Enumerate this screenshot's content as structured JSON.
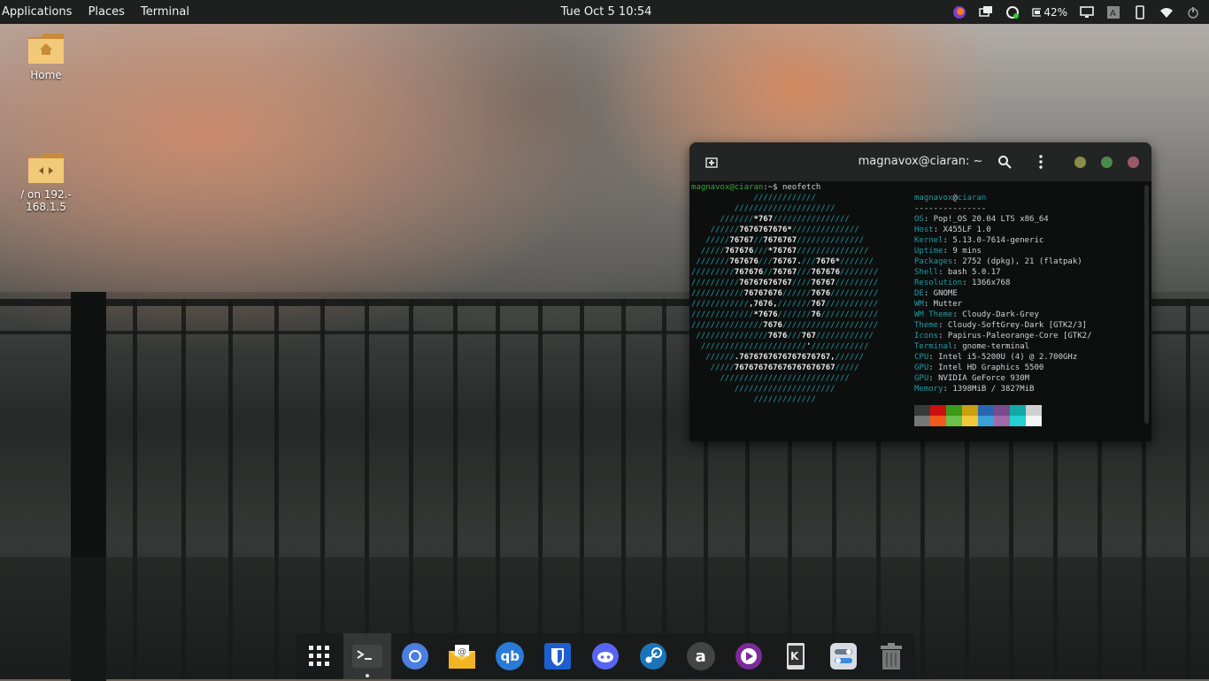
{
  "topbar": {
    "menus": [
      "Applications",
      "Places",
      "Terminal"
    ],
    "clock": "Tue Oct 5 10:54",
    "battery": "42%"
  },
  "desktop": {
    "icons": [
      {
        "label": "Home"
      },
      {
        "label": "/ on 192.-\n168.1.5"
      }
    ]
  },
  "terminal": {
    "title": "magnavox@ciaran: ~",
    "prompt_user": "magnavox@ciaran",
    "prompt_rest": ":~$ neofetch",
    "info_header_user": "magnavox",
    "info_header_at": "@",
    "info_header_host": "ciaran",
    "info_separator": "---------------",
    "info": [
      {
        "k": "OS",
        "v": "Pop!_OS 20.04 LTS x86_64"
      },
      {
        "k": "Host",
        "v": "X455LF 1.0"
      },
      {
        "k": "Kernel",
        "v": "5.13.0-7614-generic"
      },
      {
        "k": "Uptime",
        "v": "9 mins"
      },
      {
        "k": "Packages",
        "v": "2752 (dpkg), 21 (flatpak)"
      },
      {
        "k": "Shell",
        "v": "bash 5.0.17"
      },
      {
        "k": "Resolution",
        "v": "1366x768"
      },
      {
        "k": "DE",
        "v": "GNOME"
      },
      {
        "k": "WM",
        "v": "Mutter"
      },
      {
        "k": "WM Theme",
        "v": "Cloudy-Dark-Grey"
      },
      {
        "k": "Theme",
        "v": "Cloudy-SoftGrey-Dark [GTK2/3]"
      },
      {
        "k": "Icons",
        "v": "Papirus-Paleorange-Core [GTK2/"
      },
      {
        "k": "Terminal",
        "v": "gnome-terminal"
      },
      {
        "k": "CPU",
        "v": "Intel i5-5200U (4) @ 2.700GHz"
      },
      {
        "k": "GPU",
        "v": "Intel HD Graphics 5500"
      },
      {
        "k": "GPU",
        "v": "NVIDIA GeForce 930M"
      },
      {
        "k": "Memory",
        "v": "1398MiB / 3827MiB"
      }
    ],
    "swatches_dark": [
      "#3a3a3a",
      "#cc1010",
      "#3a9a1a",
      "#c8a010",
      "#2a66b0",
      "#7a4a8a",
      "#12a8a8",
      "#d0d0d0"
    ],
    "swatches_light": [
      "#777777",
      "#f05a1a",
      "#6cc04a",
      "#f0c838",
      "#3aa0d8",
      "#a06aa8",
      "#24d0d0",
      "#f4f4f4"
    ],
    "logo_lines": [
      "             /////////////",
      "         /////////////////////",
      "      ///////*767////////////////",
      "    //////7676767676*//////////////",
      "   /////76767//7676767//////////////",
      "  /////767676///*76767///////////////",
      " ///////767676///76767.///7676*///////",
      "/////////767676//76767///767676////////",
      "//////////76767676767////76767/////////",
      "///////////76767676//////7676//////////",
      "////////////,7676,///////767///////////",
      "/////////////*7676///////76////////////",
      "///////////////7676////////////////////",
      " ///////////////7676///767////////////",
      "  //////////////////////'////////////",
      "   //////.7676767676767676767,//////",
      "    /////767676767676767676767/////",
      "      ///////////////////////////",
      "         /////////////////////",
      "             /////////////"
    ]
  },
  "dock": {
    "items": [
      {
        "name": "app-grid"
      },
      {
        "name": "terminal",
        "active": true
      },
      {
        "name": "chromium"
      },
      {
        "name": "mail"
      },
      {
        "name": "qbittorrent",
        "label": "qb"
      },
      {
        "name": "bitwarden"
      },
      {
        "name": "discord"
      },
      {
        "name": "steam"
      },
      {
        "name": "amazon",
        "label": "a"
      },
      {
        "name": "media-player"
      },
      {
        "name": "kde-connect"
      },
      {
        "name": "settings"
      },
      {
        "name": "trash"
      }
    ]
  }
}
